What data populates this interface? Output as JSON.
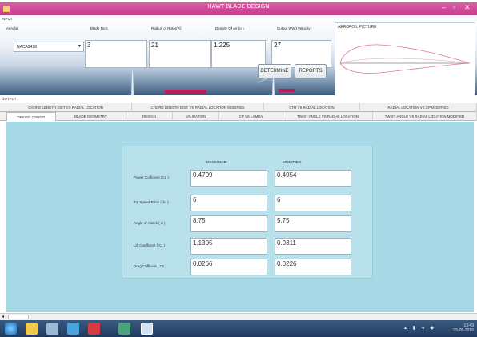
{
  "window": {
    "title": "HAWT BLADE DESIGN",
    "controls": [
      "–",
      "▫",
      "✕"
    ]
  },
  "input": {
    "section_label": "INPUT",
    "airfoil": {
      "label": "Aerofoil",
      "value": "NACA2418"
    },
    "blade_no": {
      "label": "Blade No's",
      "value": "3"
    },
    "radius": {
      "label": "Radius of Rotor(R)",
      "value": "21"
    },
    "density": {
      "label": "Density Of Air (ρ )",
      "value": "1.225"
    },
    "cutout": {
      "label": "Cutout Wind Velocity",
      "value": "27"
    },
    "determine_label": "DETERMINE",
    "reports_label": "REPORTS",
    "airfoil_picture_label": "AEROFOIL PICTURE"
  },
  "output": {
    "section_label": "OUTPUT"
  },
  "tabs_row1": [
    "CHORD LENGTH DIST VS RADIAL LOCATION",
    "CHORD LENGTH DIST. VS RADIAL LOCATION MODIFIED",
    "CTR VS RADIAL LOCATION",
    "RADIAL LOCATION VS CP MODIFIED"
  ],
  "tabs_row2": [
    "DESIGN CONDIT",
    "BLADE GEOMETRY",
    "DESIGN",
    "VALIDATION",
    "CP VS LAMDA",
    "TWIST ANGLE VS RADIAL LOCATION",
    "TWIST ANGLE VS RADIAL LOCATION MODIFIED"
  ],
  "design": {
    "designed_header": "DESIGNED",
    "modified_header": "MODIFIED",
    "rows": [
      {
        "label": "Power Cofficient (Cp )",
        "designed": "0.4709",
        "modified": "0.4954"
      },
      {
        "label": "Tip Speed Ratio ( λd )",
        "designed": "6",
        "modified": "6"
      },
      {
        "label": "Angle of Attack ( α )",
        "designed": "8.75",
        "modified": "5.75"
      },
      {
        "label": "Lift Coefficent ( Cʟ )",
        "designed": "1.1305",
        "modified": "0.9311"
      },
      {
        "label": "Drag Cofficent ( Cᴅ )",
        "designed": "0.0266",
        "modified": "0.0226"
      }
    ]
  },
  "taskbar": {
    "time": "13:49",
    "date": "05-05-2016"
  },
  "colors": {
    "title_bar": "#c63c8f",
    "content_bg": "#a6d8e6",
    "taskbar": "#1f3a5e"
  }
}
